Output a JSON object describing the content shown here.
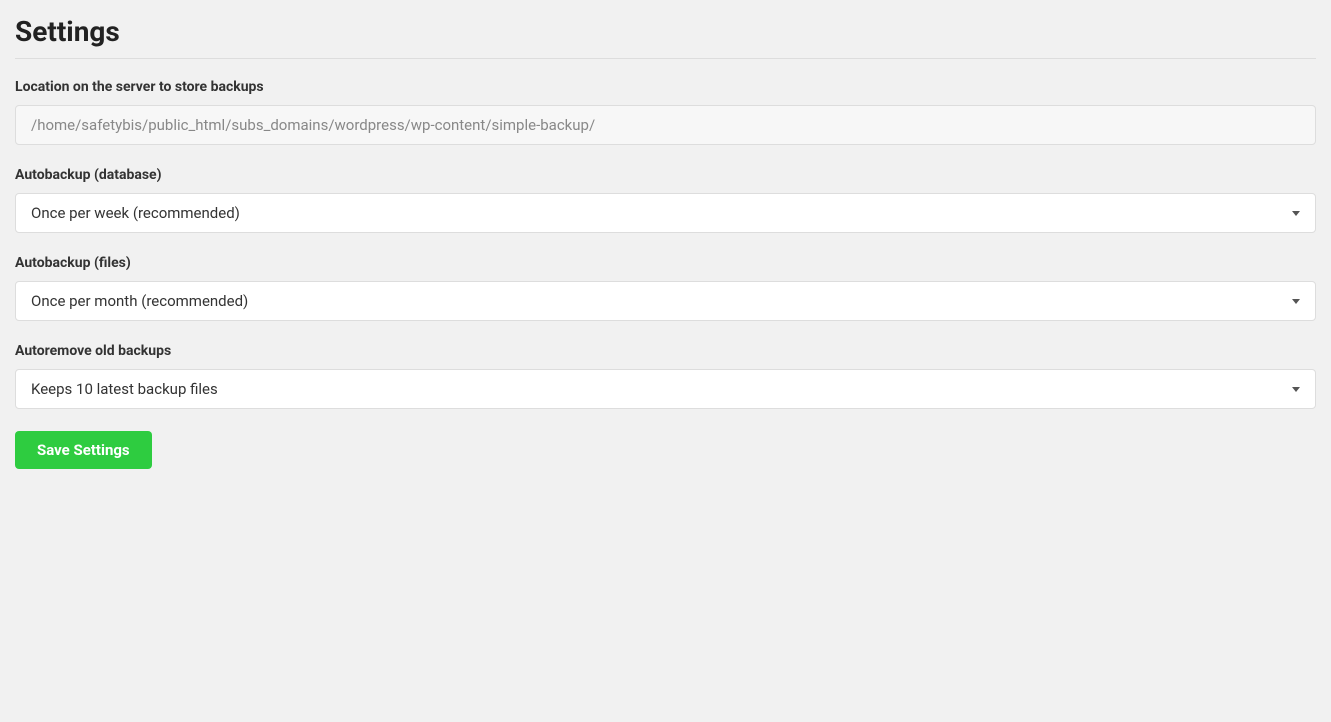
{
  "title": "Settings",
  "fields": {
    "location": {
      "label": "Location on the server to store backups",
      "value": "/home/safetybis/public_html/subs_domains/wordpress/wp-content/simple-backup/"
    },
    "autobackup_db": {
      "label": "Autobackup (database)",
      "value": "Once per week (recommended)"
    },
    "autobackup_files": {
      "label": "Autobackup (files)",
      "value": "Once per month (recommended)"
    },
    "autoremove": {
      "label": "Autoremove old backups",
      "value": "Keeps 10 latest backup files"
    }
  },
  "buttons": {
    "save": "Save Settings"
  }
}
